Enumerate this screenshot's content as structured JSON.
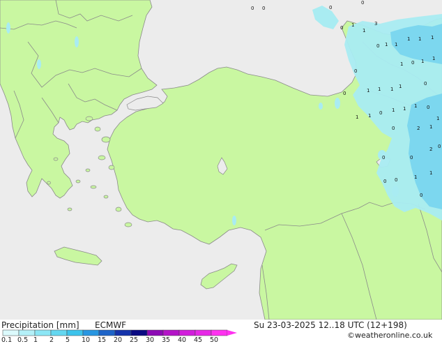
{
  "product": {
    "title": "Precipitation [mm]",
    "model": "ECMWF",
    "valid_time": "Su 23-03-2025 12..18 UTC (12+198)",
    "credit": "©weatheronline.co.uk"
  },
  "colors": {
    "sea": "#ececec",
    "land": "#c9f7a1",
    "border": "#8a8a8a",
    "rain_light": "#a9ecf2",
    "rain_medium": "#79d6ee"
  },
  "legend": {
    "ticks": [
      "0.1",
      "0.5",
      "1",
      "2",
      "5",
      "10",
      "15",
      "20",
      "25",
      "30",
      "35",
      "40",
      "45",
      "50"
    ],
    "colors": [
      "#dcfafc",
      "#b4f0f8",
      "#8ce6f5",
      "#64d7f0",
      "#3cc3eb",
      "#2896e1",
      "#1e64c8",
      "#1432aa",
      "#0a0a82",
      "#8c0ab4",
      "#b414c8",
      "#d21edc",
      "#e628e6",
      "#ff32f0"
    ]
  },
  "map_labels": [
    {
      "text": "0"
    },
    {
      "text": "0"
    },
    {
      "text": "0"
    },
    {
      "text": "0"
    },
    {
      "text": "3"
    },
    {
      "text": "0"
    },
    {
      "text": "1"
    },
    {
      "text": "1"
    },
    {
      "text": "1"
    },
    {
      "text": "1"
    },
    {
      "text": "1"
    },
    {
      "text": "1"
    },
    {
      "text": "1"
    },
    {
      "text": "0"
    },
    {
      "text": "1"
    },
    {
      "text": "0"
    },
    {
      "text": "1"
    },
    {
      "text": "1"
    },
    {
      "text": "0"
    },
    {
      "text": "1"
    },
    {
      "text": "0"
    },
    {
      "text": "1"
    },
    {
      "text": "1"
    },
    {
      "text": "1"
    },
    {
      "text": "0"
    },
    {
      "text": "1"
    },
    {
      "text": "0"
    },
    {
      "text": "1"
    },
    {
      "text": "1"
    },
    {
      "text": "0"
    },
    {
      "text": "1"
    },
    {
      "text": "1"
    },
    {
      "text": "0"
    },
    {
      "text": "0"
    },
    {
      "text": "0"
    },
    {
      "text": "2"
    },
    {
      "text": "1"
    },
    {
      "text": "1"
    },
    {
      "text": "2"
    },
    {
      "text": "0"
    },
    {
      "text": "0"
    },
    {
      "text": "1"
    },
    {
      "text": "0"
    },
    {
      "text": "1"
    },
    {
      "text": "0"
    }
  ]
}
